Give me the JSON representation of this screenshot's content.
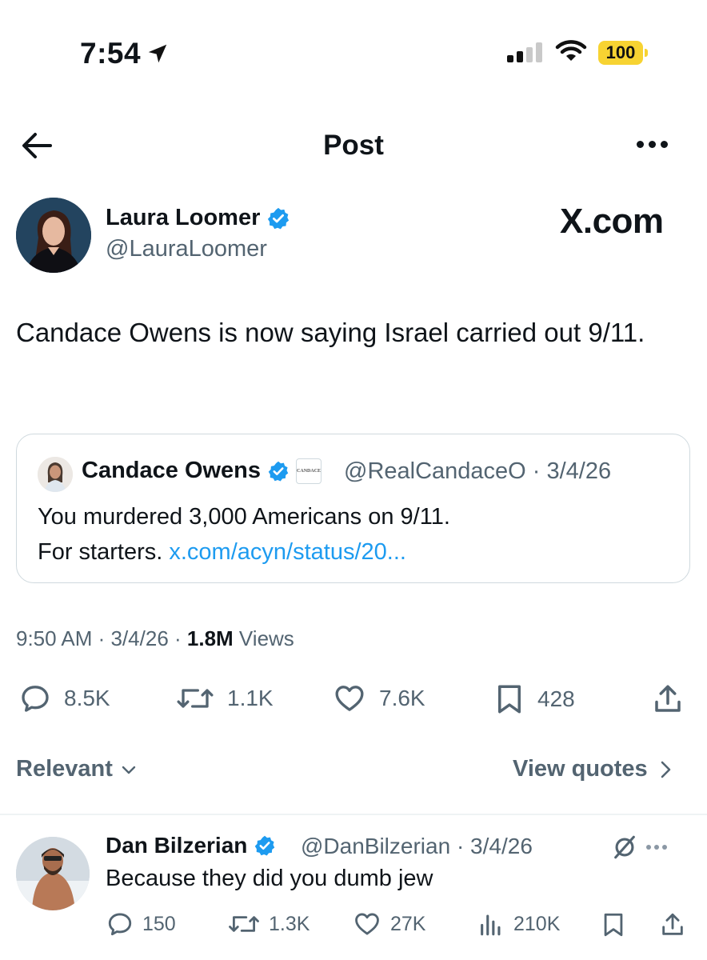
{
  "status_bar": {
    "time": "7:54",
    "battery": "100"
  },
  "header": {
    "title": "Post"
  },
  "post": {
    "author_name": "Laura Loomer",
    "author_handle": "@LauraLoomer",
    "watermark": "X.com",
    "text": "Candace Owens is now saying Israel carried out 9/11.",
    "quote": {
      "name": "Candace Owens",
      "affiliate_badge": "CANDACE",
      "handle_date": "@RealCandaceO · 3/4/26",
      "line1": "You murdered 3,000 Americans on 9/11.",
      "line2": "For starters.",
      "link": "x.com/acyn/status/20..."
    },
    "meta": {
      "time_date": "9:50 AM · 3/4/26 · ",
      "views_count": "1.8M",
      "views_label": " Views"
    },
    "actions": {
      "replies": "8.5K",
      "reposts": "1.1K",
      "likes": "7.6K",
      "bookmarks": "428"
    }
  },
  "sort": {
    "label": "Relevant",
    "view_quotes": "View quotes"
  },
  "reply": {
    "name": "Dan Bilzerian",
    "handle_date": "@DanBilzerian · 3/4/26",
    "text": "Because they did you dumb jew",
    "actions": {
      "replies": "150",
      "reposts": "1.3K",
      "likes": "27K",
      "views": "210K"
    }
  },
  "colors": {
    "link": "#1d9bf0",
    "verified": "#1d9bf0",
    "secondary_text": "#536471",
    "battery": "#f7d332"
  }
}
